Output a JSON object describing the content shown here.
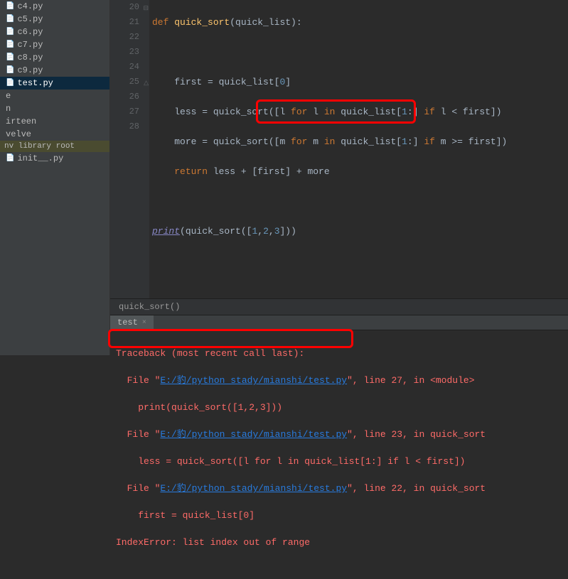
{
  "sidebar": {
    "files": [
      {
        "name": "c4.py",
        "selected": false
      },
      {
        "name": "c5.py",
        "selected": false
      },
      {
        "name": "c6.py",
        "selected": false
      },
      {
        "name": "c7.py",
        "selected": false
      },
      {
        "name": "c8.py",
        "selected": false
      },
      {
        "name": "c9.py",
        "selected": false
      },
      {
        "name": "test.py",
        "selected": true
      },
      {
        "name": "e",
        "selected": false
      },
      {
        "name": "n",
        "selected": false
      },
      {
        "name": "irteen",
        "selected": false
      },
      {
        "name": "velve",
        "selected": false
      }
    ],
    "lib_label": "nv library root",
    "init_file": "init__.py"
  },
  "editor": {
    "line_start": 20,
    "code": {
      "l20_def": "def",
      "l20_fn": "quick_sort",
      "l20_rest": "(quick_list):",
      "l22": "first = quick_list[",
      "l22_idx": "0",
      "l22_end": "]",
      "l23_a": "less = quick_sort([l ",
      "l23_for": "for",
      "l23_b": " l ",
      "l23_in": "in",
      "l23_c": " quick_list[",
      "l23_n": "1",
      "l23_d": ":] ",
      "l23_if": "if",
      "l23_e": " l < first])",
      "l24_a": "more = quick_sort([m ",
      "l24_for": "for",
      "l24_b": " m ",
      "l24_in": "in",
      "l24_c": " quick_list[",
      "l24_n": "1",
      "l24_d": ":] ",
      "l24_if": "if",
      "l24_e": " m >= first])",
      "l25_ret": "return",
      "l25": " less + [first] + more",
      "l27_print": "print",
      "l27_a": "(quick_sort([",
      "l27_n1": "1",
      "l27_c1": ",",
      "l27_n2": "2",
      "l27_c2": ",",
      "l27_n3": "3",
      "l27_end": "]))"
    },
    "breadcrumb": "quick_sort()"
  },
  "run": {
    "tab_name": "test",
    "close": "×"
  },
  "console": {
    "l1": "Traceback (most recent call last):",
    "l2a": "  File \"",
    "l2link": "E:/豹/python_stady/mianshi/test.py",
    "l2b": "\", line 27, in <module>",
    "l3": "    print(quick_sort([1,2,3]))",
    "l4a": "  File \"",
    "l4link": "E:/豹/python_stady/mianshi/test.py",
    "l4b": "\", line 23, in quick_sort",
    "l5": "    less = quick_sort([l for l in quick_list[1:] if l < first])",
    "l6a": "  File \"",
    "l6link": "E:/豹/python_stady/mianshi/test.py",
    "l6b": "\", line 22, in quick_sort",
    "l7": "    first = quick_list[0]",
    "l8": "IndexError: list index out of range"
  }
}
